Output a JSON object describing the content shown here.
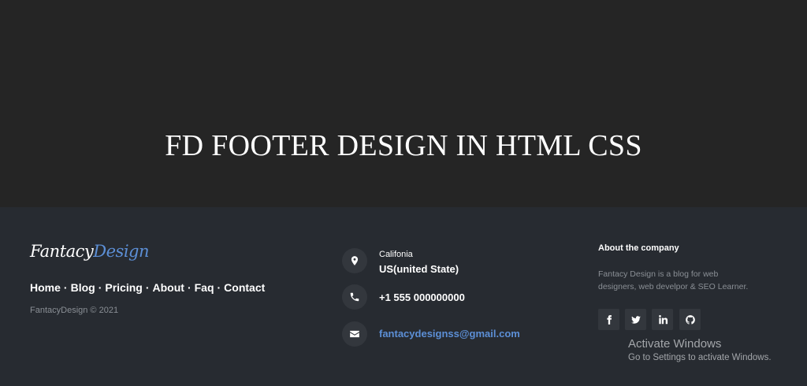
{
  "hero": {
    "title": "FD FOOTER DESIGN IN HTML CSS"
  },
  "footer": {
    "logo": {
      "part1": "Fantacy",
      "part2": "Design"
    },
    "links": [
      "Home",
      "Blog",
      "Pricing",
      "About",
      "Faq",
      "Contact"
    ],
    "link_separator": "·",
    "copyright": "FantacyDesign © 2021",
    "contact": {
      "location_small": "Califonia",
      "location_big": "US(united State)",
      "phone": "+1 555 000000000",
      "email": "fantacydesignss@gmail.com",
      "icons": [
        "map-marker-icon",
        "phone-icon",
        "envelope-icon"
      ]
    },
    "about": {
      "title": "About the company",
      "text": "Fantacy Design is a blog for web designers, web develpor & SEO Learner."
    },
    "social": [
      "facebook-icon",
      "twitter-icon",
      "linkedin-icon",
      "github-icon"
    ]
  },
  "watermark": {
    "title": "Activate Windows",
    "subtitle": "Go to Settings to activate Windows."
  },
  "colors": {
    "hero_bg": "#252525",
    "footer_bg": "#272b31",
    "accent": "#5c8fd6",
    "muted_text": "#8a8f95",
    "icon_bg": "#33373d"
  }
}
